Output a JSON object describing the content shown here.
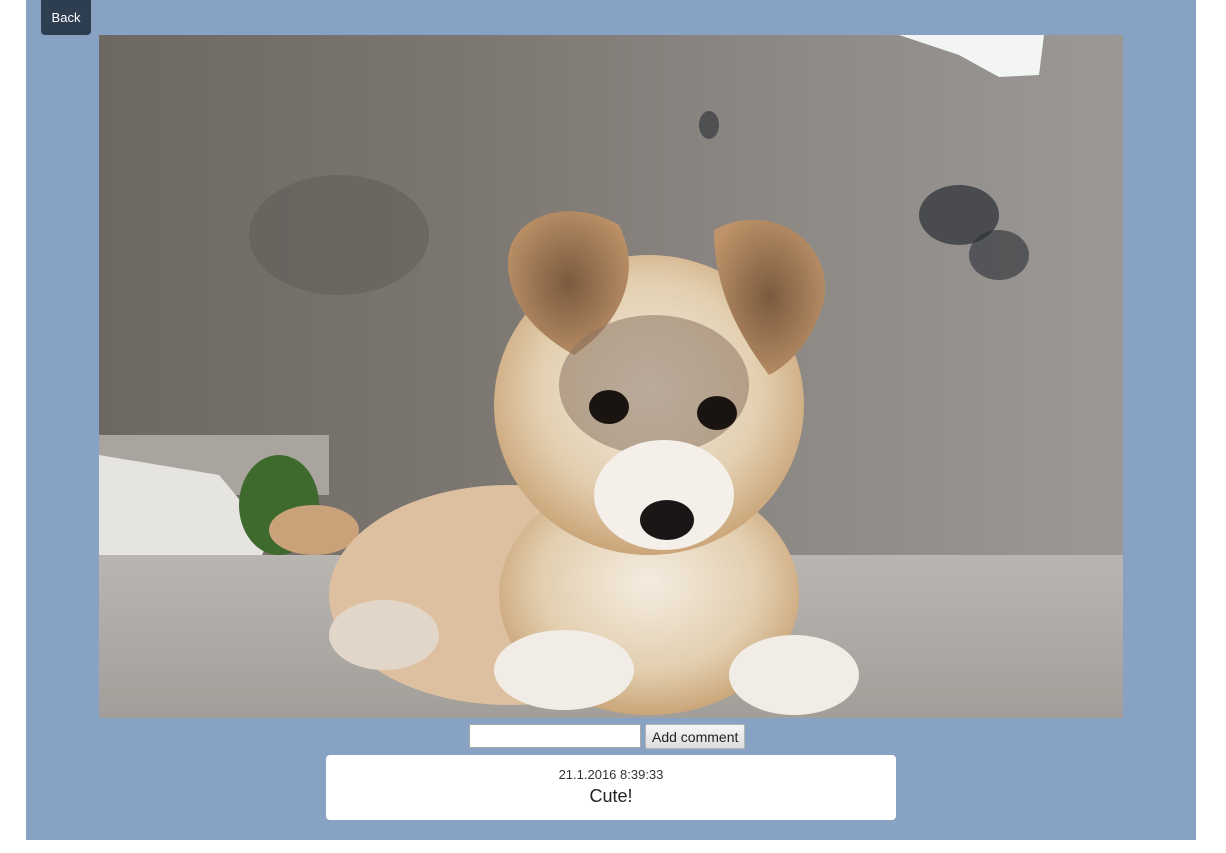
{
  "nav": {
    "back_label": "Back"
  },
  "photo": {
    "subject": "puppy-photo"
  },
  "comment_form": {
    "input_value": "",
    "input_placeholder": "",
    "submit_label": "Add comment"
  },
  "comments": [
    {
      "timestamp": "21.1.2016 8:39:33",
      "text": "Cute!"
    }
  ],
  "colors": {
    "panel_background": "#87a2c2",
    "back_button": "#2c3e50",
    "comment_card": "#ffffff"
  }
}
